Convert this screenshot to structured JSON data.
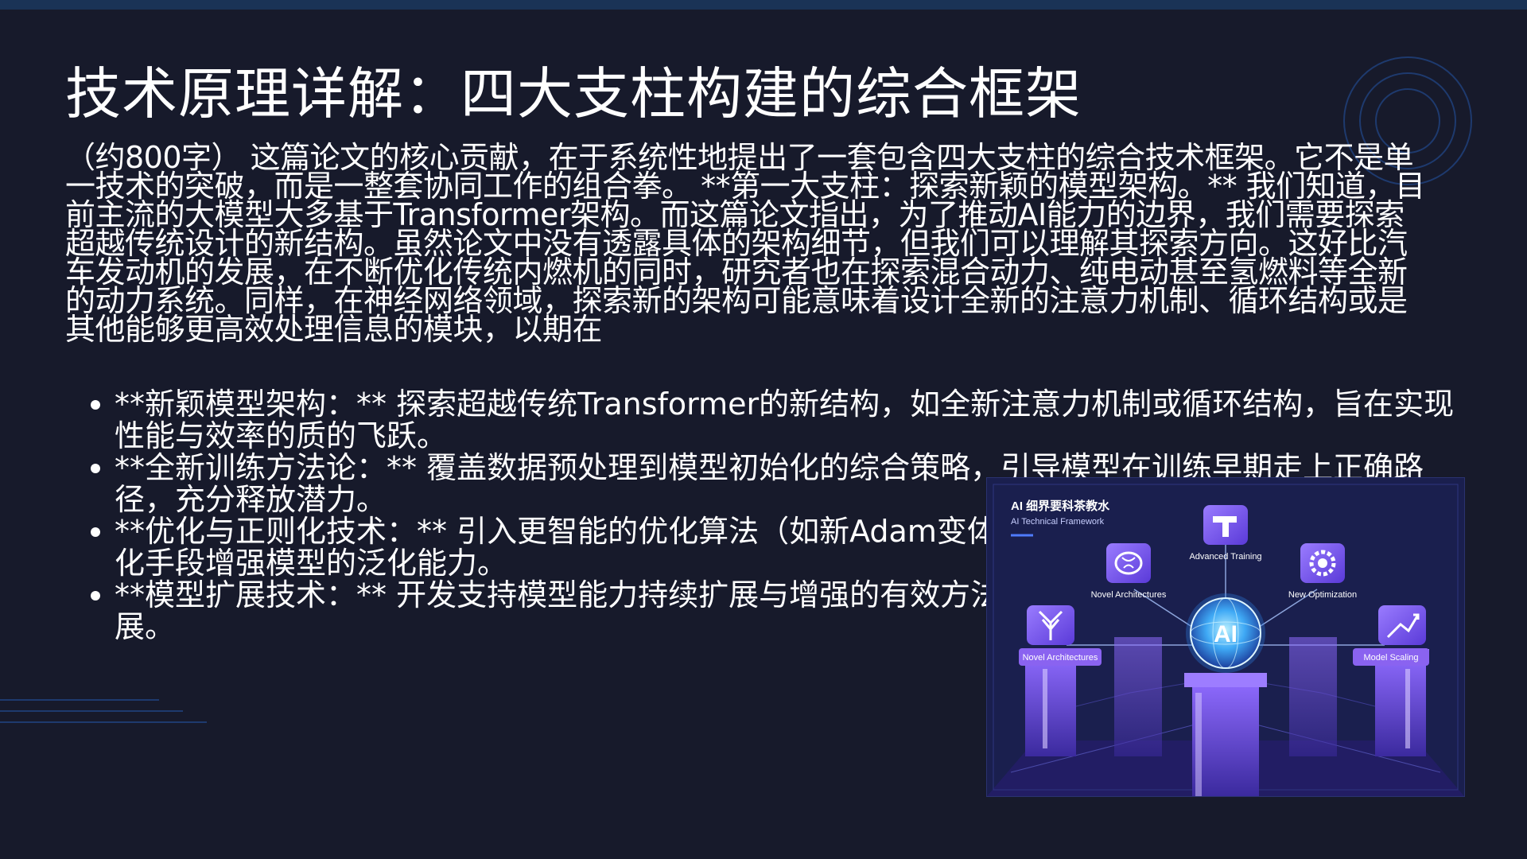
{
  "slide": {
    "title": "技术原理详解：四大支柱构建的综合框架",
    "paragraph": "（约800字） 这篇论文的核心贡献，在于系统性地提出了一套包含四大支柱的综合技术框架。它不是单一技术的突破，而是一整套协同工作的组合拳。 **第一大支柱：探索新颖的模型架构。** 我们知道，目前主流的大模型大多基于Transformer架构。而这篇论文指出，为了推动AI能力的边界，我们需要探索超越传统设计的新结构。虽然论文中没有透露具体的架构细节，但我们可以理解其探索方向。这好比汽车发动机的发展，在不断优化传统内燃机的同时，研究者也在探索混合动力、纯电动甚至氢燃料等全新的动力系统。同样，在神经网络领域，探索新的架构可能意味着设计全新的注意力机制、循环结构或是其他能够更高效处理信息的模块，以期在",
    "bullets": [
      "**新颖模型架构：** 探索超越传统Transformer的新结构，如全新注意力机制或循环结构，旨在实现性能与效率的质的飞跃。",
      "**全新训练方法论：** 覆盖数据预处理到模型初始化的综合策略，引导模型在训练早期走上正确路径，充分释放潜力。",
      "**优化与正则化技术：** 引入更智能的优化算法（如新Adam变体）加速收敛，并利用更有效的正则化手段增强模型的泛化能力。",
      "**模型扩展技术：** 开发支持模型能力持续扩展与增强的有效方法，实现模型规模与能力的同步扩展。"
    ]
  },
  "figure": {
    "header_title": "AI 细界要科茶教水",
    "header_subtitle": "AI Technical Framework",
    "center_label": "AI",
    "labels": {
      "top": "Advanced Training",
      "upper_left": "Novel Architectures",
      "upper_right": "New Optimization",
      "lower_left": "Novel Architectures",
      "lower_right": "Model Scaling"
    },
    "icons": [
      "tools-icon",
      "brain-icon",
      "gear-check-icon",
      "tree-network-icon",
      "growth-arrows-icon"
    ],
    "colors": {
      "background": "#1a1f4e",
      "accent_purple": "#7c4dff",
      "accent_cyan": "#4fc3f7",
      "label_bg": "#8a63f0"
    }
  },
  "colors": {
    "slide_background": "#171a2b",
    "top_bar": "#1a3356",
    "text": "#ffffff"
  }
}
